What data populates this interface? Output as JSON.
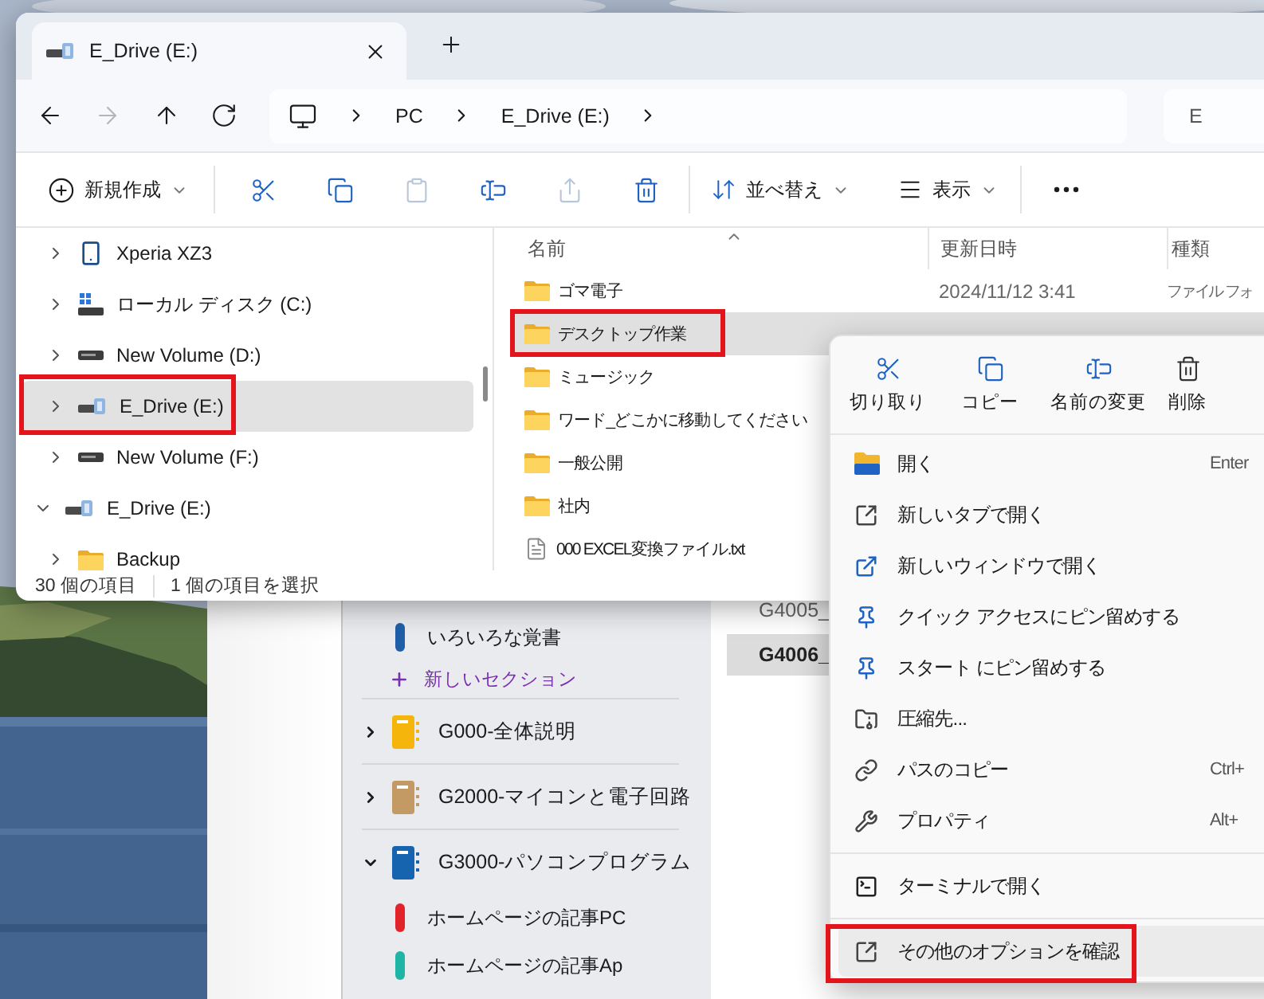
{
  "explorer": {
    "tabs": [
      {
        "title": "E_Drive (E:)",
        "selected": true
      }
    ],
    "nav_buttons": [
      {
        "disabled": false
      },
      {
        "disabled": true
      },
      {
        "disabled": false
      },
      {
        "disabled": false
      }
    ],
    "address": {
      "crumbs": [
        "PC",
        "E_Drive (E:)"
      ]
    },
    "search": {
      "placeholder": "E"
    },
    "toolbar": {
      "new_label": "新規作成",
      "actions": [
        {
          "disabled": false
        },
        {
          "disabled": false
        },
        {
          "disabled": true
        },
        {
          "disabled": false
        },
        {
          "disabled": true
        },
        {
          "disabled": false
        }
      ],
      "sort_label": "並べ替え",
      "view_label": "表示"
    },
    "nav_pane": {
      "pc_items": [
        {
          "label": "Xperia XZ3",
          "expanded": false,
          "selected": false,
          "highlighted": false
        },
        {
          "label": "ローカル ディスク (C:)",
          "expanded": false,
          "selected": false,
          "highlighted": false
        },
        {
          "label": "New Volume (D:)",
          "expanded": false,
          "selected": false,
          "highlighted": false
        },
        {
          "label": "E_Drive (E:)",
          "expanded": false,
          "selected": true,
          "highlighted": true
        },
        {
          "label": "New Volume (F:)",
          "expanded": false,
          "selected": false,
          "highlighted": false
        }
      ],
      "root_items": [
        {
          "label": "E_Drive (E:)",
          "expanded": true,
          "selected": false,
          "highlighted": false,
          "children": [
            {
              "label": "Backup",
              "expanded": false,
              "selected": false,
              "highlighted": false
            }
          ]
        }
      ]
    },
    "columns": [
      "名前",
      "更新日時",
      "種類"
    ],
    "files": [
      {
        "kind": "folder",
        "name": "ゴマ電子",
        "modified": "2024/11/12 3:41",
        "type": "ファイル フォ",
        "selected": false,
        "highlighted": false
      },
      {
        "kind": "folder",
        "name": "デスクトップ作業",
        "selected": true,
        "highlighted": true
      },
      {
        "kind": "folder",
        "name": "ミュージック",
        "selected": false,
        "highlighted": false
      },
      {
        "kind": "folder",
        "name": "ワード_どこかに移動してください",
        "selected": false,
        "highlighted": false
      },
      {
        "kind": "folder",
        "name": "一般公開",
        "selected": false,
        "highlighted": false
      },
      {
        "kind": "folder",
        "name": "社内",
        "selected": false,
        "highlighted": false
      },
      {
        "kind": "file",
        "name": "000 EXCEL変換ファイル.txt",
        "selected": false,
        "highlighted": false
      }
    ],
    "status": {
      "item_count": "30 個の項目",
      "selection": "1 個の項目を選択"
    }
  },
  "context_menu": {
    "quick_actions": [
      "切り取り",
      "コピー",
      "名前の変更",
      "削除"
    ],
    "items": [
      {
        "kind": "command",
        "label": "開く",
        "shortcut": "Enter",
        "hovered": false,
        "highlighted": false
      },
      {
        "kind": "command",
        "label": "新しいタブで開く",
        "hovered": false,
        "highlighted": false
      },
      {
        "kind": "command",
        "label": "新しいウィンドウで開く",
        "hovered": false,
        "highlighted": false
      },
      {
        "kind": "command",
        "label": "クイック アクセスにピン留めする",
        "hovered": false,
        "highlighted": false
      },
      {
        "kind": "command",
        "label": "スタート にピン留めする",
        "hovered": false,
        "highlighted": false
      },
      {
        "kind": "command",
        "label": "圧縮先...",
        "hovered": false,
        "highlighted": false
      },
      {
        "kind": "command",
        "label": "パスのコピー",
        "shortcut": "Ctrl+",
        "hovered": false,
        "highlighted": false
      },
      {
        "kind": "command",
        "label": "プロパティ",
        "shortcut": "Alt+",
        "hovered": false,
        "highlighted": false
      },
      {
        "kind": "separator"
      },
      {
        "kind": "command",
        "label": "ターミナルで開く",
        "hovered": false,
        "highlighted": false
      },
      {
        "kind": "separator"
      },
      {
        "kind": "command",
        "label": "その他のオプションを確認",
        "hovered": true,
        "highlighted": true
      }
    ]
  },
  "onenote": {
    "pages": [
      {
        "title": "G4005_",
        "selected": false
      },
      {
        "title": "G4006_",
        "selected": true
      }
    ],
    "open_sections": [
      {
        "name": "いろいろな覚書",
        "color": "#1f5fa8"
      }
    ],
    "new_section": "新しいセクション",
    "notebooks": [
      {
        "name": "G000-全体説明",
        "color": "#f5b50a",
        "expanded": false
      },
      {
        "name": "G2000-マイコンと電子回路",
        "color": "#c49a64",
        "expanded": false
      },
      {
        "name": "G3000-パソコンプログラム",
        "color": "#1663b0",
        "expanded": true,
        "sections": [
          {
            "name": "ホームページの記事PC",
            "color": "#e0242a"
          },
          {
            "name": "ホームページの記事Ap",
            "color": "#1fb5a5"
          }
        ]
      }
    ]
  }
}
